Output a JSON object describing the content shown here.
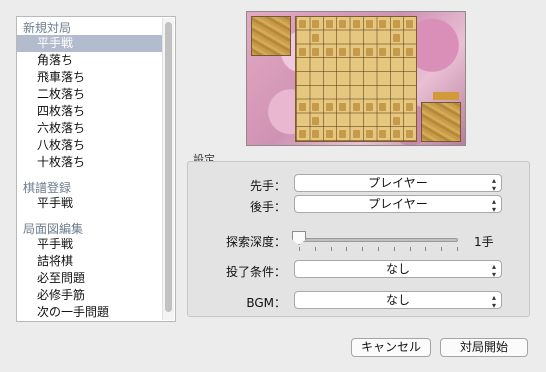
{
  "sidebar": {
    "groups": [
      {
        "title": "新規対局",
        "items": [
          "平手戦",
          "角落ち",
          "飛車落ち",
          "二枚落ち",
          "四枚落ち",
          "六枚落ち",
          "八枚落ち",
          "十枚落ち"
        ]
      },
      {
        "title": "棋譜登録",
        "items": [
          "平手戦"
        ]
      },
      {
        "title": "局面図編集",
        "items": [
          "平手戦",
          "詰将棋",
          "必至問題",
          "必修手筋",
          "次の一手問題"
        ]
      }
    ],
    "selected": "新規対局 / 平手戦"
  },
  "settings": {
    "section_label": "設定",
    "sente_label": "先手：",
    "sente_value": "プレイヤー",
    "gote_label": "後手：",
    "gote_value": "プレイヤー",
    "depth_label": "探索深度：",
    "depth_value": "1手",
    "depth_level": 0,
    "resign_label": "投了条件：",
    "resign_value": "なし",
    "bgm_label": "BGM：",
    "bgm_value": "なし"
  },
  "buttons": {
    "cancel": "キャンセル",
    "start": "対局開始"
  },
  "preview": {
    "icon": "shogi-board-preview"
  }
}
